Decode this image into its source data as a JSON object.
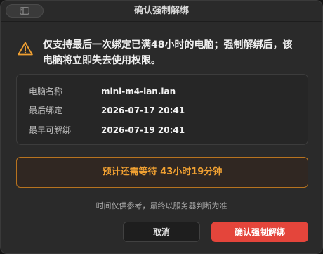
{
  "window": {
    "title": "确认强制解绑"
  },
  "warning": {
    "icon": "warning-triangle-icon",
    "icon_color": "#f0a032",
    "text": "仅支持最后一次绑定已满48小时的电脑；强制解绑后，该电脑将立即失去使用权限。"
  },
  "info": {
    "rows": [
      {
        "label": "电脑名称",
        "value": "mini-m4-lan.lan"
      },
      {
        "label": "最后绑定",
        "value": "2026-07-17 20:41"
      },
      {
        "label": "最早可解绑",
        "value": "2026-07-19 20:41"
      }
    ]
  },
  "wait": {
    "text": "预计还需等待 43小时19分钟",
    "accent": "#f0a032"
  },
  "hint": "时间仅供参考，最终以服务器判断为准",
  "buttons": {
    "cancel": "取消",
    "confirm": "确认强制解绑",
    "confirm_color": "#e4453b"
  }
}
